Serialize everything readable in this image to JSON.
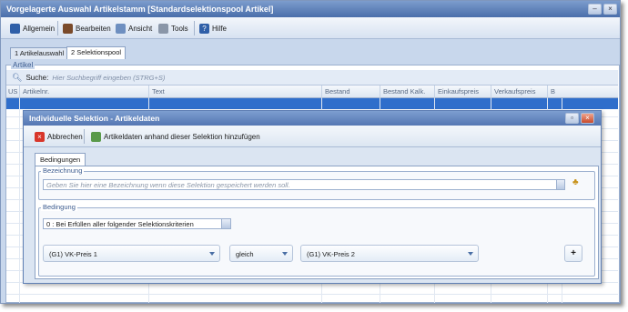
{
  "window": {
    "title": "Vorgelagerte Auswahl Artikelstamm [Standardselektionspool Artikel]"
  },
  "menu": [
    {
      "label": "Allgemein",
      "icon": "pin-icon"
    },
    {
      "label": "Bearbeiten",
      "icon": "edit-icon"
    },
    {
      "label": "Ansicht",
      "icon": "view-icon"
    },
    {
      "label": "Tools",
      "icon": "tools-icon"
    },
    {
      "label": "Hilfe",
      "icon": "help-icon"
    }
  ],
  "tabs": [
    {
      "label": "1 Artikelauswahl",
      "active": false
    },
    {
      "label": "2 Selektionspool",
      "active": true
    }
  ],
  "group": {
    "title": "Artikel"
  },
  "search": {
    "label": "Suche:",
    "placeholder": "Hier Suchbegriff eingeben (STRG+S)"
  },
  "grid": {
    "columns": [
      "US",
      "Artikelnr.",
      "Text",
      "Bestand",
      "Bestand Kalk.",
      "Einkaufspreis",
      "Verkaufspreis",
      "B"
    ]
  },
  "dialog": {
    "title": "Individuelle Selektion - Artikeldaten",
    "cancel_label": "Abbrechen",
    "add_label": "Artikeldaten anhand dieser Selektion hinzufügen",
    "tab_label": "Bedingungen",
    "bezeichnung": {
      "legend": "Bezeichnung",
      "placeholder": "Geben Sie hier eine Bezeichnung wenn diese Selektion gespeichert werden soll."
    },
    "bedingung": {
      "legend": "Bedingung",
      "mode": "0 : Bei Erfüllen aller folgender Selektionskriterien",
      "left": "(G1) VK-Preis 1",
      "operator": "gleich",
      "right": "(G1) VK-Preis 2",
      "add_label": "+"
    }
  },
  "colors": {
    "accent": "#2f6ecb",
    "titlebar": "#4a6eaa",
    "background": "#c8d7ec"
  }
}
